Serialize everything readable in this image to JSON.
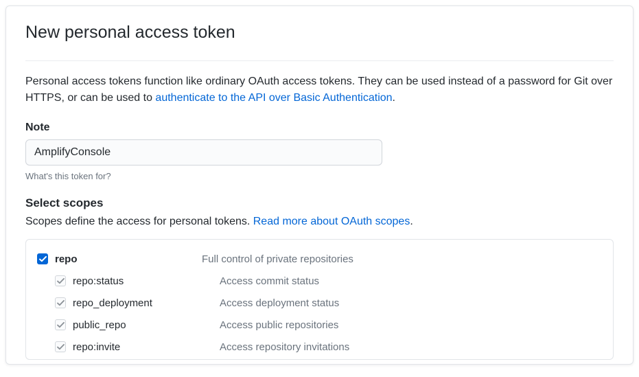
{
  "title": "New personal access token",
  "description_part1": "Personal access tokens function like ordinary OAuth access tokens. They can be used instead of a password for Git over HTTPS, or can be used to ",
  "description_link": "authenticate to the API over Basic Authentication",
  "description_part2": ".",
  "note": {
    "label": "Note",
    "value": "AmplifyConsole",
    "hint": "What's this token for?"
  },
  "scopes": {
    "title": "Select scopes",
    "desc_part1": "Scopes define the access for personal tokens. ",
    "desc_link": "Read more about OAuth scopes",
    "desc_part2": ".",
    "items": [
      {
        "name": "repo",
        "desc": "Full control of private repositories",
        "checked": true,
        "parent": true,
        "disabled": false
      },
      {
        "name": "repo:status",
        "desc": "Access commit status",
        "checked": true,
        "parent": false,
        "disabled": true
      },
      {
        "name": "repo_deployment",
        "desc": "Access deployment status",
        "checked": true,
        "parent": false,
        "disabled": true
      },
      {
        "name": "public_repo",
        "desc": "Access public repositories",
        "checked": true,
        "parent": false,
        "disabled": true
      },
      {
        "name": "repo:invite",
        "desc": "Access repository invitations",
        "checked": true,
        "parent": false,
        "disabled": true
      }
    ]
  }
}
